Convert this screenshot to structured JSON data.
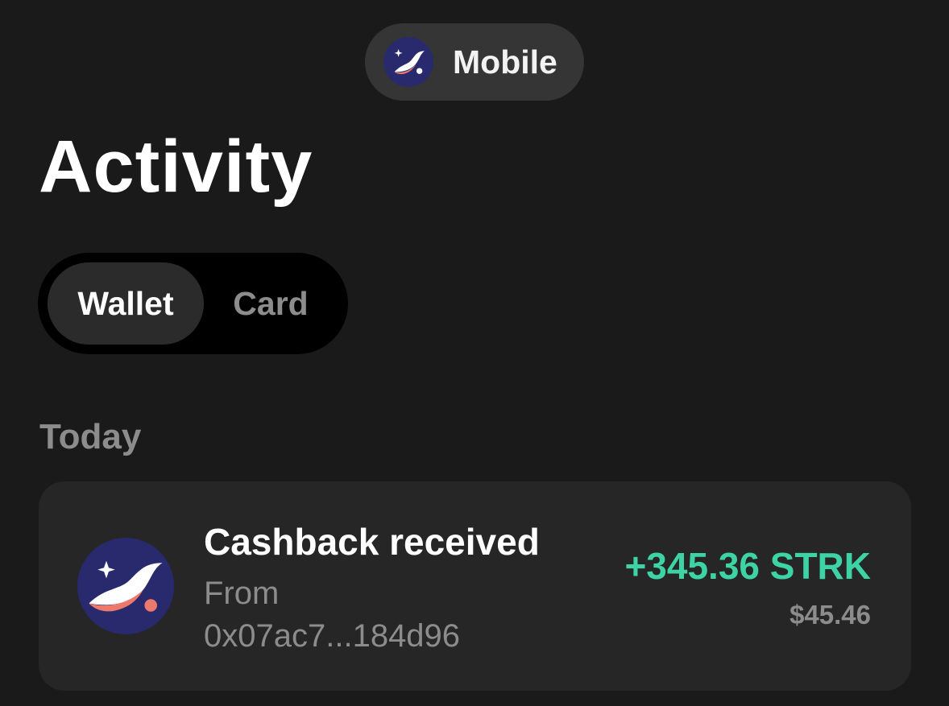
{
  "network": {
    "label": "Mobile",
    "logo_icon": "starknet-logo-icon"
  },
  "page_title": "Activity",
  "tabs": [
    {
      "label": "Wallet",
      "selected": true
    },
    {
      "label": "Card",
      "selected": false
    }
  ],
  "sections": [
    {
      "label": "Today",
      "transactions": [
        {
          "icon": "starknet-token-icon",
          "title": "Cashback received",
          "from_label": "From",
          "address": "0x07ac7...184d96",
          "amount": "+345.36 STRK",
          "fiat": "$45.46"
        }
      ]
    }
  ],
  "colors": {
    "background": "#1a1a1a",
    "card": "#262626",
    "positive": "#3dd3a4",
    "muted": "#8c8c8c",
    "logo_bg": "#29296e",
    "logo_accent": "#ec796b"
  }
}
